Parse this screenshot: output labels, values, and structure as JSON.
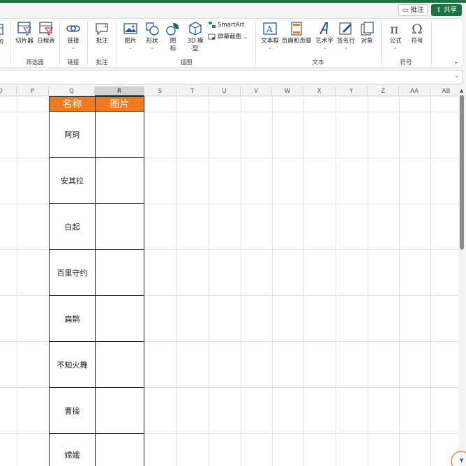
{
  "title_bar": {
    "comment_label": "批注",
    "share_label": "共享",
    "accent_color": "#1e7145"
  },
  "ribbon": {
    "buttons": {
      "slicer": "切片器",
      "timeline": "日程表",
      "link": "链接",
      "comment": "批注",
      "picture": "图片",
      "shapes": "形状",
      "icons_line1": "图",
      "icons_line2": "标",
      "model3d_line1": "3D 模",
      "model3d_line2": "型",
      "smartart": "SmartArt",
      "screenshot": "屏幕截图",
      "textbox": "文本框",
      "header_footer": "页眉和页脚",
      "wordart": "艺术字",
      "signature": "签名行",
      "object": "对象",
      "equation": "公式",
      "symbol": "符号"
    },
    "groups": {
      "filters": "筛选器",
      "links": "链接",
      "comments": "批注",
      "illustrations": "插图",
      "text": "文本",
      "symbols": "符号"
    }
  },
  "sheet": {
    "columns": [
      "O",
      "P",
      "Q",
      "R",
      "S",
      "T",
      "U",
      "V",
      "W",
      "X",
      "Y",
      "Z",
      "AA",
      "AB"
    ],
    "selected_column": "R",
    "table_header": {
      "name": "名称",
      "picture": "图片",
      "header_color": "#f07b1f"
    },
    "rows": [
      "阿珂",
      "安其拉",
      "白起",
      "百里守约",
      "扁鹊",
      "不知火舞",
      "曹操",
      "嫦娥"
    ]
  }
}
